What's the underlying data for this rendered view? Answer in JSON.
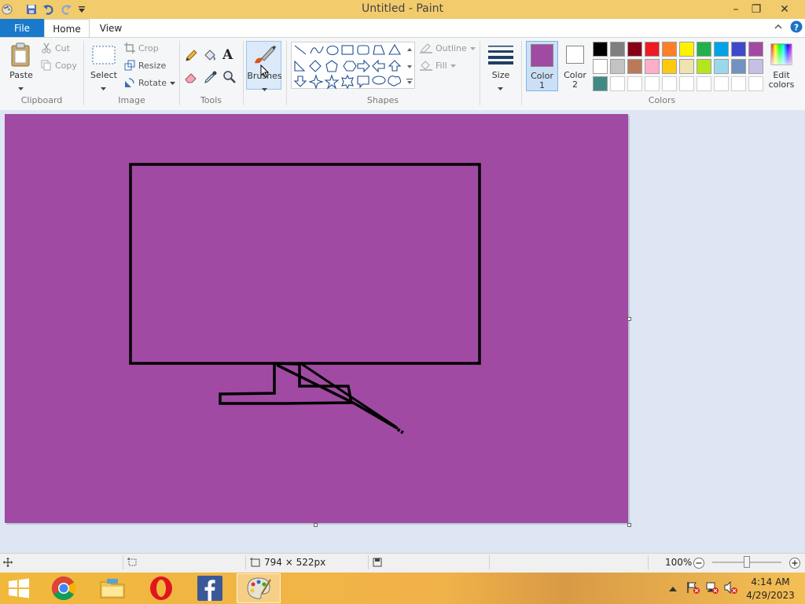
{
  "window": {
    "title": "Untitled - Paint",
    "minimize_glyph": "–",
    "maximize_glyph": "❐",
    "close_glyph": "✕"
  },
  "tabs": {
    "file": "File",
    "home": "Home",
    "view": "View"
  },
  "ribbon": {
    "clipboard": {
      "paste": "Paste",
      "cut": "Cut",
      "copy": "Copy",
      "group": "Clipboard"
    },
    "image": {
      "select": "Select",
      "crop": "Crop",
      "resize": "Resize",
      "rotate": "Rotate",
      "group": "Image"
    },
    "tools": {
      "group": "Tools",
      "text_glyph": "A"
    },
    "brushes": "Brushes",
    "shapes": {
      "outline": "Outline",
      "fill": "Fill",
      "group": "Shapes"
    },
    "size": "Size",
    "color1": {
      "label_line1": "Color",
      "label_line2": "1",
      "value": "#a04aa3"
    },
    "color2": {
      "label_line1": "Color",
      "label_line2": "2",
      "value": "#ffffff"
    },
    "edit_colors": {
      "line1": "Edit",
      "line2": "colors"
    },
    "colors_group": "Colors",
    "palette_row1": [
      "#000000",
      "#7f7f7f",
      "#880015",
      "#ed1c24",
      "#ff7f27",
      "#fff200",
      "#22b14c",
      "#00a2e8",
      "#3f48cc",
      "#a349a4"
    ],
    "palette_row2": [
      "#ffffff",
      "#c3c3c3",
      "#b97a57",
      "#ffaec9",
      "#ffc90e",
      "#efe4b0",
      "#b5e61d",
      "#99d9ea",
      "#7092be",
      "#c8bfe7"
    ],
    "palette_row3": [
      "#3f8a84",
      "",
      "",
      "",
      "",
      "",
      "",
      "",
      "",
      ""
    ]
  },
  "canvas": {
    "background": "#a04aa3",
    "stroke": "#000000"
  },
  "status": {
    "dimensions": "794 × 522px",
    "zoom": "100%"
  },
  "taskbar": {
    "time": "4:14 AM",
    "date": "4/29/2023"
  }
}
